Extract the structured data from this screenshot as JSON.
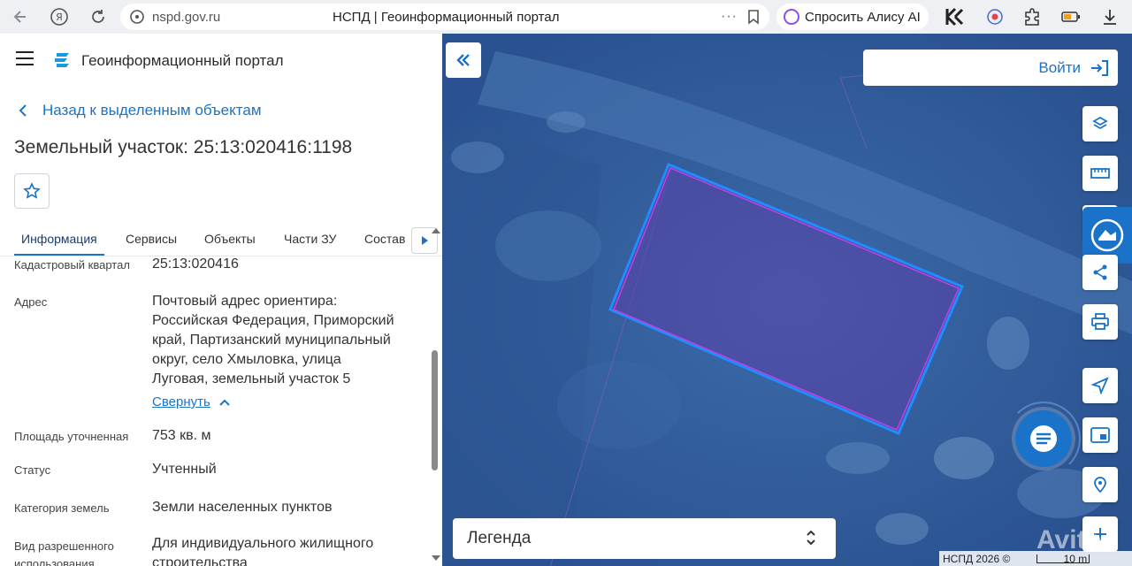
{
  "browser": {
    "url": "nspd.gov.ru",
    "tab_title": "НСПД | Геоинформационный портал",
    "more": "···",
    "alice_label": "Спросить Алису AI"
  },
  "app": {
    "title": "Геоинформационный портал",
    "back_label": "Назад к выделенным объектам",
    "parcel_title": "Земельный участок: 25:13:020416:1198"
  },
  "tabs": [
    {
      "label": "Информация",
      "active": true
    },
    {
      "label": "Сервисы",
      "active": false
    },
    {
      "label": "Объекты",
      "active": false
    },
    {
      "label": "Части ЗУ",
      "active": false
    },
    {
      "label": "Состав",
      "active": false
    }
  ],
  "info": {
    "cadastral_quarter_label": "Кадастровый квартал",
    "cadastral_quarter_value": "25:13:020416",
    "address_label": "Адрес",
    "address_lines": [
      "Почтовый адрес ориентира:",
      "Российская Федерация, Приморский",
      "край, Партизанский муниципальный",
      "округ, село Хмыловка, улица",
      "Луговая, земельный участок 5"
    ],
    "collapse_label": "Свернуть",
    "area_label": "Площадь уточненная",
    "area_value": "753 кв. м",
    "status_label": "Статус",
    "status_value": "Учтенный",
    "land_category_label": "Категория земель",
    "land_category_value": "Земли населенных пунктов",
    "permitted_use_label_1": "Вид разрешенного",
    "permitted_use_label_2": "использования",
    "permitted_use_value_1": "Для индивидуального жилищного",
    "permitted_use_value_2": "строительства"
  },
  "map": {
    "login_label": "Войти",
    "legend_label": "Легенда",
    "copyright": "НСПД 2026 ©",
    "scale_label": "10 m",
    "watermark": "Avito"
  },
  "colors": {
    "accent": "#1a73c8",
    "parcel_fill": "#5a3fa8",
    "parcel_stroke": "#b040d8",
    "map_tint": "#2f5a98"
  }
}
